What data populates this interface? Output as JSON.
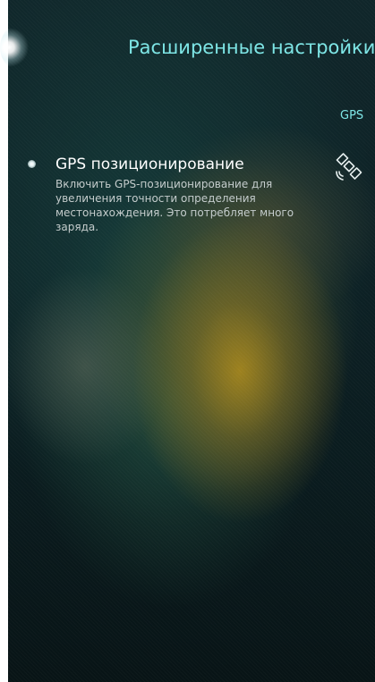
{
  "header": {
    "title": "Расширенные настройки"
  },
  "section": {
    "label": "GPS"
  },
  "setting": {
    "title": "GPS позиционирование",
    "description": "Включить GPS-позиционирование для увеличения точности определения местонахождения. Это потребляет много заряда.",
    "icon": "satellite-icon"
  },
  "colors": {
    "accent": "#7ee6e6",
    "title_text": "#ffffff",
    "description_text": "#c4cccc"
  }
}
